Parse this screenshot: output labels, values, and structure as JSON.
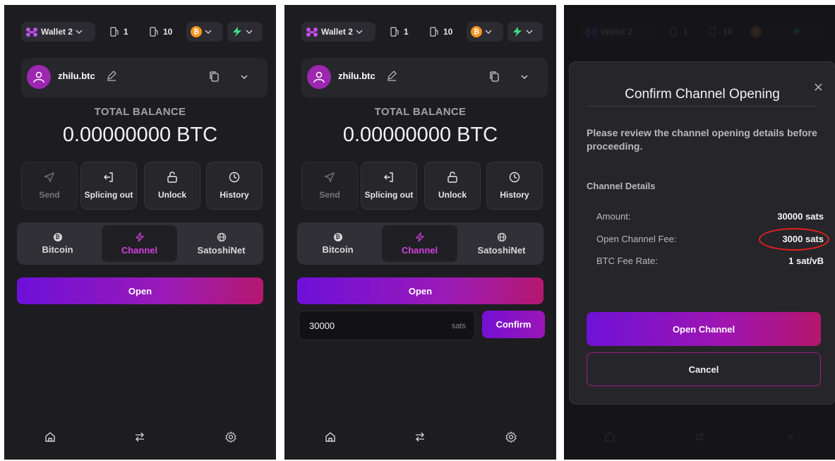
{
  "topbar": {
    "wallet_label": "Wallet 2",
    "fuel_a": "1",
    "fuel_b": "10",
    "btc_symbol": "₿",
    "accent_btc": "#f7931a",
    "accent_ln": "#3ddc84"
  },
  "account": {
    "name": "zhilu.btc"
  },
  "balance": {
    "label": "TOTAL BALANCE",
    "value": "0.00000000 BTC"
  },
  "actions": [
    {
      "label": "Send",
      "icon": "send-icon"
    },
    {
      "label": "Splicing out",
      "icon": "splice-out-icon"
    },
    {
      "label": "Unlock",
      "icon": "unlock-icon"
    },
    {
      "label": "History",
      "icon": "clock-icon"
    }
  ],
  "tabs": [
    {
      "label": "Bitcoin",
      "icon": "bitcoin-icon"
    },
    {
      "label": "Channel",
      "icon": "lightning-icon"
    },
    {
      "label": "SatoshiNet",
      "icon": "globe-icon"
    }
  ],
  "open_label": "Open",
  "amount_input": {
    "value": "30000",
    "unit": "sats",
    "confirm_label": "Confirm"
  },
  "nav": [
    "home-icon",
    "swap-icon",
    "settings-icon"
  ],
  "dialog": {
    "title": "Confirm Channel Opening",
    "close": "×",
    "description": "Please review the channel opening details before proceeding.",
    "section": "Channel Details",
    "rows": [
      {
        "label": "Amount:",
        "value": "30000 sats"
      },
      {
        "label": "Open Channel Fee:",
        "value": "3000 sats"
      },
      {
        "label": "BTC Fee Rate:",
        "value": "1 sat/vB"
      }
    ],
    "open_channel_label": "Open Channel",
    "cancel_label": "Cancel"
  },
  "colors": {
    "accent": "#9c27b0",
    "channel_active": "#d63fe0",
    "highlight_ring": "#e02020"
  }
}
